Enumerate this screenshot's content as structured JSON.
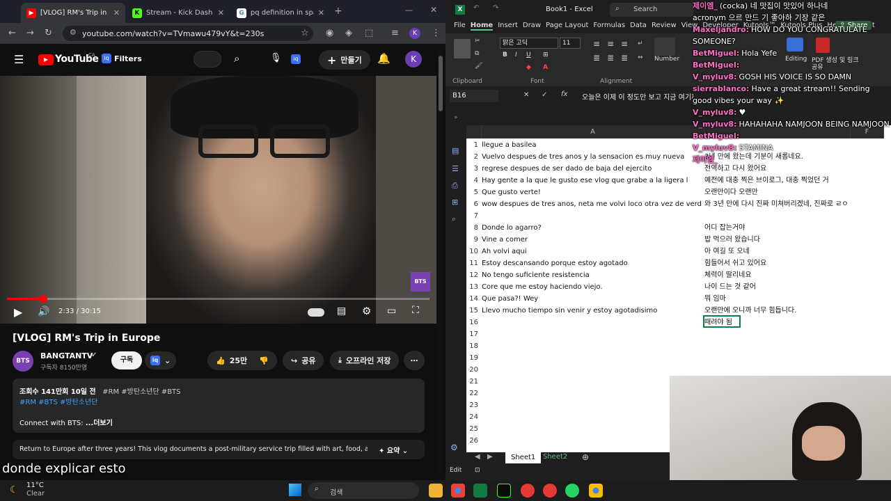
{
  "browser": {
    "tabs": [
      {
        "label": "[VLOG] RM's Trip in Eu",
        "color": "#ff0000",
        "glyph": "▶"
      },
      {
        "label": "Stream - Kick Dashboa",
        "color": "#53fc18",
        "glyph": "K"
      },
      {
        "label": "pq definition in spanis",
        "color": "#4285f4",
        "glyph": "G"
      }
    ],
    "url": "youtube.com/watch?v=TVmawu479vY&t=230s"
  },
  "youtube": {
    "logo": "YouTube",
    "region": "CA",
    "filters": "Filters",
    "create": "만들기",
    "avatar": "K",
    "video_badge": "BTS",
    "time": "2:33 / 30:15",
    "progress_fraction": 0.085,
    "title": "[VLOG] RM's Trip in Europe",
    "channel": "BANGTANTV",
    "subscribers": "구독자 8150만명",
    "subscribe": "구독",
    "likes": "25만",
    "share": "공유",
    "save": "오프라인 저장",
    "views": "조회수 141만회  10일 전",
    "tags_line1": "#RM #방탄소년단 #BTS",
    "tags_line2": "#RM #BTS #방탄소년단",
    "connect": "Connect with BTS:",
    "more": "...더보기",
    "summary": "Return to Europe after three years! This vlog documents a post-military service trip filled with art, food, and...",
    "summary_btn": "요약"
  },
  "excel": {
    "title": "Book1 - Excel",
    "search": "Search",
    "menu": [
      "File",
      "Home",
      "Insert",
      "Draw",
      "Page Layout",
      "Formulas",
      "Data",
      "Review",
      "View",
      "Developer",
      "Kutools™",
      "Kutools Plus",
      "Help",
      "Acrobat"
    ],
    "share": "Share",
    "font_name": "맑은 고딕",
    "font_size": "11",
    "number": "Number",
    "editing": "Editing",
    "pdf": "PDF 생성 및 링크 공유",
    "groups": [
      "Clipboard",
      "Font",
      "Alignment"
    ],
    "namebox": "B16",
    "formula": "오늘은 이제 이 정도만 보고 지금 여기까지만 할게요",
    "col_a": "A",
    "col_f": "F",
    "rows": [
      {
        "n": "1",
        "a": "llegue a basilea",
        "b": ""
      },
      {
        "n": "2",
        "a": "Vuelvo despues de tres anos y la sensacion es muy nueva",
        "b": "3년 만에 왔는데 기분이 새롭네요."
      },
      {
        "n": "3",
        "a": "regrese despues de ser dado de baja del ejercito",
        "b": "전역하고 다시 왔어요"
      },
      {
        "n": "4",
        "a": "Hay gente a la que le gusto ese vlog que grabe a la ligera l",
        "b": "예전에 대충 찍은 브이로그, 대충 찍었던 거"
      },
      {
        "n": "5",
        "a": "Que gusto verte!",
        "b": "오랜만이다 오랜만"
      },
      {
        "n": "6",
        "a": "wow despues de tres anos, neta me volvi loco otra vez de verd",
        "b": "와 3년 만에 다시 진짜 미쳐버리겠네, 진짜로 ㄹㅇ"
      },
      {
        "n": "7",
        "a": "",
        "b": ""
      },
      {
        "n": "8",
        "a": "Donde lo agarro?",
        "b": "어디 잡는거야"
      },
      {
        "n": "9",
        "a": "Vine a comer",
        "b": "밥 먹으러 왔습니다"
      },
      {
        "n": "10",
        "a": "Ah volvi aqui",
        "b": "아 여길 또 오네"
      },
      {
        "n": "11",
        "a": "Estoy descansando porque estoy agotado",
        "b": "힘들어서 쉬고 있어요"
      },
      {
        "n": "12",
        "a": "No tengo suficiente resistencia",
        "b": "체력이 딸리네요"
      },
      {
        "n": "13",
        "a": "Core que me estoy haciendo viejo.",
        "b": "나이 드는 것 같어"
      },
      {
        "n": "14",
        "a": "Que pasa?! Wey",
        "b": "뭐 임마"
      },
      {
        "n": "15",
        "a": "Llevo mucho tiempo sin venir y estoy agotadisimo",
        "b": "오랜만에 오니까 너무 힘듭니다."
      },
      {
        "n": "16",
        "a": "",
        "b": "때려야 됨"
      },
      {
        "n": "17",
        "a": "",
        "b": ""
      },
      {
        "n": "18",
        "a": "",
        "b": ""
      },
      {
        "n": "19",
        "a": "",
        "b": ""
      },
      {
        "n": "20",
        "a": "",
        "b": ""
      },
      {
        "n": "21",
        "a": "",
        "b": ""
      },
      {
        "n": "22",
        "a": "",
        "b": ""
      },
      {
        "n": "23",
        "a": "",
        "b": ""
      },
      {
        "n": "24",
        "a": "",
        "b": ""
      },
      {
        "n": "25",
        "a": "",
        "b": ""
      },
      {
        "n": "26",
        "a": "",
        "b": ""
      }
    ],
    "sheets": [
      "Sheet1",
      "Sheet2"
    ],
    "status": "Edit"
  },
  "chat": [
    {
      "user": "제이엠_",
      "color": "#ff6ec7",
      "text": "(cocka) 네 맛집이 맛있어 하나네"
    },
    {
      "user": "",
      "color": "#ffffff",
      "text": "acronym 으르 만드 기 좋아하 기장 같은"
    },
    {
      "user": "Maxeljandro:",
      "color": "#ff6ec7",
      "text": "HOW DO YOU CONGRATULATE"
    },
    {
      "user": "",
      "color": "#ffffff",
      "text": "SOMEONE?"
    },
    {
      "user": "BetMiguel:",
      "color": "#ff6ec7",
      "text": "Hola Yefe"
    },
    {
      "user": "BetMiguel:",
      "color": "#ff6ec7",
      "text": ""
    },
    {
      "user": "V_myluv8:",
      "color": "#ff6ec7",
      "text": "GOSH HIS VOICE IS SO DAMN"
    },
    {
      "user": "sierrablanco:",
      "color": "#ff6ec7",
      "text": "Have a great stream!! Sending good vibes your way ✨"
    },
    {
      "user": "V_myluv8:",
      "color": "#ff6ec7",
      "text": "♥"
    },
    {
      "user": "V_myluv8:",
      "color": "#ff6ec7",
      "text": "HAHAHAHA NAMJOON BEING NAMJOON"
    },
    {
      "user": "BetMiguel:",
      "color": "#ff6ec7",
      "text": ""
    },
    {
      "user": "V_myluv8:",
      "color": "#ff6ec7",
      "text": "STAMINA"
    },
    {
      "user": "제이엠_",
      "color": "#ff6ec7",
      "text": ""
    }
  ],
  "caption": "donde explicar esto",
  "taskbar": {
    "temp": "11°C",
    "weather": "Clear",
    "search": "검색"
  }
}
